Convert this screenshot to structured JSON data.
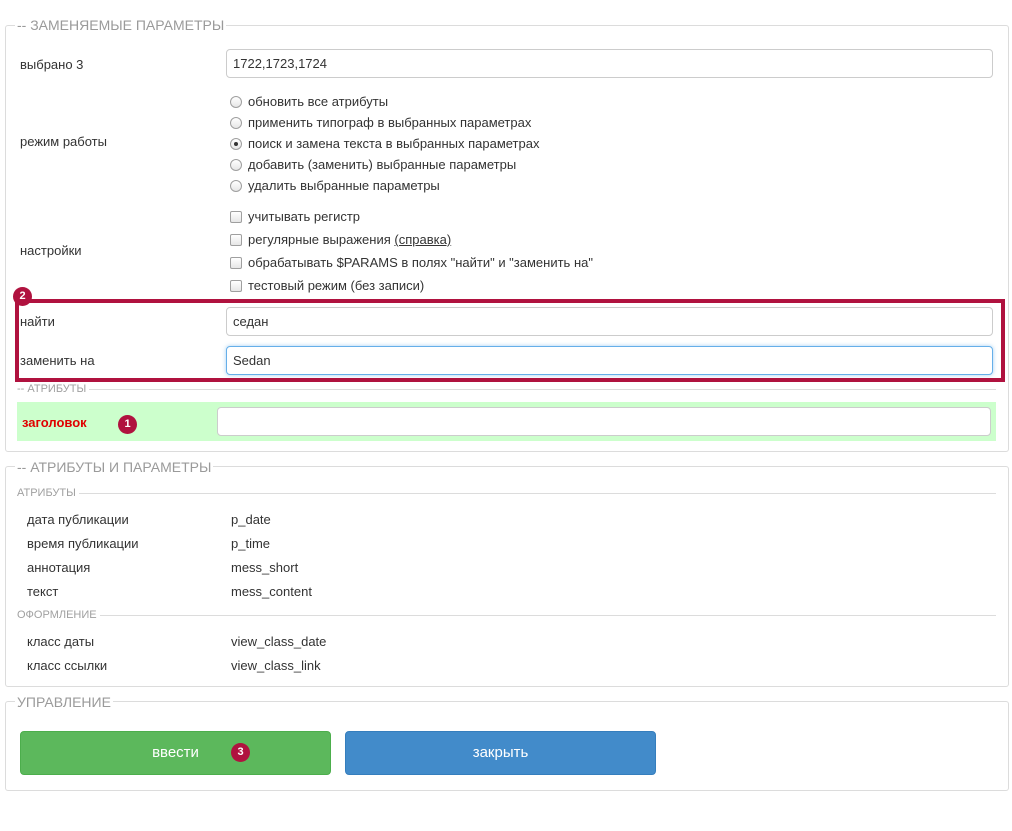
{
  "replace_section": {
    "legend": "-- ЗАМЕНЯЕМЫЕ ПАРАМЕТРЫ",
    "selected_label": "выбрано 3",
    "selected_value": "1722,1723,1724",
    "mode_label": "режим работы",
    "modes": [
      {
        "label": "обновить все атрибуты",
        "checked": false
      },
      {
        "label": "применить типограф в выбранных параметрах",
        "checked": false
      },
      {
        "label": "поиск и замена текста в выбранных параметрах",
        "checked": true
      },
      {
        "label": "добавить (заменить) выбранные параметры",
        "checked": false
      },
      {
        "label": "удалить выбранные параметры",
        "checked": false
      }
    ],
    "settings_label": "настройки",
    "settings": {
      "case": "учитывать регистр",
      "regex": "регулярные выражения",
      "regex_help": "(справка)",
      "params": "обрабатывать $PARAMS в полях \"найти\" и \"заменить на\"",
      "test": "тестовый режим (без записи)"
    },
    "find_label": "найти",
    "find_value": "седан",
    "replace_label": "заменить на",
    "replace_value": "Sedan",
    "attributes_legend": "-- АТРИБУТЫ",
    "title_label": "заголовок",
    "title_value": ""
  },
  "annotations": {
    "badge1": "1",
    "badge2": "2",
    "badge3": "3",
    "highlight_color": "#b0123f"
  },
  "attrs_section": {
    "legend": "-- АТРИБУТЫ И ПАРАМЕТРЫ",
    "attributes_heading": "АТРИБУТЫ",
    "attributes": [
      {
        "label": "дата публикации",
        "value": "p_date"
      },
      {
        "label": "время публикации",
        "value": "p_time"
      },
      {
        "label": "аннотация",
        "value": "mess_short"
      },
      {
        "label": "текст",
        "value": "mess_content"
      }
    ],
    "design_heading": "ОФОРМЛЕНИЕ",
    "design": [
      {
        "label": "класс даты",
        "value": "view_class_date"
      },
      {
        "label": "класс ссылки",
        "value": "view_class_link"
      }
    ]
  },
  "control_section": {
    "legend": "УПРАВЛЕНИЕ",
    "submit_label": "ввести",
    "close_label": "закрыть",
    "submit_color": "#5cb85c",
    "close_color": "#428bca"
  }
}
